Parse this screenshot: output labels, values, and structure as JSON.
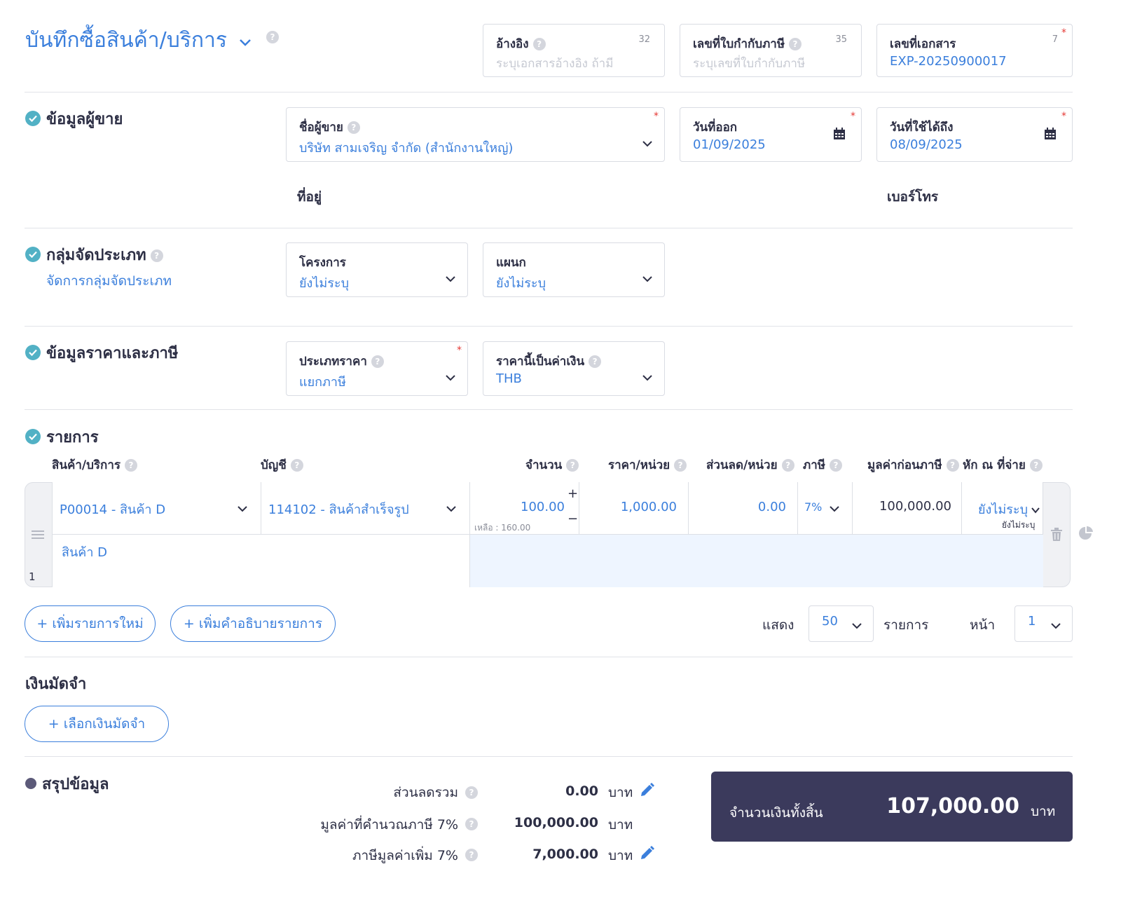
{
  "header": {
    "title": "บันทึกซื้อสินค้า/บริการ",
    "reference": {
      "label": "อ้างอิง",
      "counter": "32",
      "placeholder": "ระบุเอกสารอ้างอิง ถ้ามี"
    },
    "tax_invoice": {
      "label": "เลขที่ใบกำกับภาษี",
      "counter": "35",
      "placeholder": "ระบุเลขที่ใบกำกับภาษี"
    },
    "doc_no": {
      "label": "เลขที่เอกสาร",
      "counter": "7",
      "value": "EXP-20250900017"
    }
  },
  "vendor": {
    "section_title": "ข้อมูลผู้ขาย",
    "name_label": "ชื่อผู้ขาย",
    "name_value": "บริษัท สามเจริญ จำกัด (สำนักงานใหญ่)",
    "issue_date_label": "วันที่ออก",
    "issue_date": "01/09/2025",
    "valid_until_label": "วันที่ใช้ได้ถึง",
    "valid_until": "08/09/2025",
    "address_label": "ที่อยู่",
    "phone_label": "เบอร์โทร"
  },
  "classification": {
    "section_title": "กลุ่มจัดประเภท",
    "manage_link": "จัดการกลุ่มจัดประเภท",
    "project_label": "โครงการ",
    "project_value": "ยังไม่ระบุ",
    "department_label": "แผนก",
    "department_value": "ยังไม่ระบุ"
  },
  "pricing": {
    "section_title": "ข้อมูลราคาและภาษี",
    "price_type_label": "ประเภทราคา",
    "price_type_value": "แยกภาษี",
    "currency_label": "ราคานี้เป็นค่าเงิน",
    "currency_value": "THB"
  },
  "items": {
    "section_title": "รายการ",
    "columns": {
      "product": "สินค้า/บริการ",
      "account": "บัญชี",
      "qty": "จำนวน",
      "unit_price": "ราคา/หน่วย",
      "discount": "ส่วนลด/หน่วย",
      "tax": "ภาษี",
      "pre_tax": "มูลค่าก่อนภาษี",
      "withholding": "หัก ณ ที่จ่าย"
    },
    "rows": [
      {
        "index": "1",
        "product": "P00014 - สินค้า D",
        "account": "114102 - สินค้าสำเร็จรูป",
        "qty": "100.00",
        "remaining": "เหลือ : 160.00",
        "unit_price": "1,000.00",
        "discount": "0.00",
        "tax": "7%",
        "pre_tax": "100,000.00",
        "withholding": "ยังไม่ระบุ",
        "withholding_sub": "ยังไม่ระบุ",
        "description": "สินค้า D"
      }
    ],
    "add_item": "+ เพิ่มรายการใหม่",
    "add_description": "+ เพิ่มคำอธิบายรายการ",
    "show_label": "แสดง",
    "page_size": "50",
    "items_label": "รายการ",
    "page_label": "หน้า",
    "page": "1"
  },
  "deposit": {
    "section_title": "เงินมัดจำ",
    "select_button": "+ เลือกเงินมัดจำ"
  },
  "summary": {
    "section_title": "สรุปข้อมูล",
    "rows": [
      {
        "label": "ส่วนลดรวม",
        "value": "0.00",
        "unit": "บาท"
      },
      {
        "label": "มูลค่าที่คำนวณภาษี 7%",
        "value": "100,000.00",
        "unit": "บาท"
      },
      {
        "label": "ภาษีมูลค่าเพิ่ม 7%",
        "value": "7,000.00",
        "unit": "บาท"
      }
    ],
    "total_label": "จำนวนเงินทั้งสิ้น",
    "total_value": "107,000.00",
    "total_unit": "บาท"
  },
  "colors": {
    "accent": "#3b7fdc",
    "check": "#52b1c5",
    "total_bg": "#3b3a5c",
    "row_highlight": "#eef5ff"
  },
  "icons": [
    "chevron-down-icon",
    "help-icon",
    "calendar-icon",
    "check-circle-icon",
    "drag-handle-icon",
    "trash-icon",
    "pie-chart-icon",
    "pencil-icon",
    "plus-icon",
    "minus-icon"
  ]
}
